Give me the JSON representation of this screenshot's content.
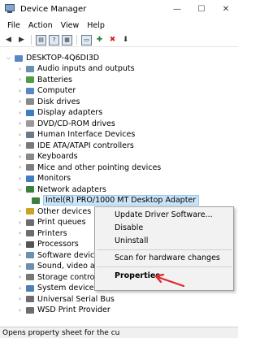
{
  "window": {
    "title": "Device Manager",
    "minimize": "—",
    "maximize": "☐",
    "close": "✕"
  },
  "menu": [
    "File",
    "Action",
    "View",
    "Help"
  ],
  "toolbar": {
    "icons": [
      "back-icon",
      "forward-icon",
      "properties-icon",
      "help-icon",
      "driver-icon",
      "monitor-icon",
      "add-device-icon",
      "uninstall-icon",
      "update-driver-icon"
    ]
  },
  "tree": {
    "root": "DESKTOP-4Q6DI3D",
    "items": [
      {
        "label": "Audio inputs and outputs",
        "icon": "speaker-icon",
        "color": "#6b8fb3"
      },
      {
        "label": "Batteries",
        "icon": "battery-icon",
        "color": "#4f9b4a"
      },
      {
        "label": "Computer",
        "icon": "computer-icon",
        "color": "#5a87c5"
      },
      {
        "label": "Disk drives",
        "icon": "disk-drive-icon",
        "color": "#8a8a8a"
      },
      {
        "label": "Display adapters",
        "icon": "display-adapter-icon",
        "color": "#3f7fc0"
      },
      {
        "label": "DVD/CD-ROM drives",
        "icon": "dvd-drive-icon",
        "color": "#9a9a9a"
      },
      {
        "label": "Human Interface Devices",
        "icon": "hid-icon",
        "color": "#6c7a8c"
      },
      {
        "label": "IDE ATA/ATAPI controllers",
        "icon": "ide-controller-icon",
        "color": "#7a7a7a"
      },
      {
        "label": "Keyboards",
        "icon": "keyboard-icon",
        "color": "#8a8a8a"
      },
      {
        "label": "Mice and other pointing devices",
        "icon": "mouse-icon",
        "color": "#7d7d7d"
      },
      {
        "label": "Monitors",
        "icon": "monitor-icon",
        "color": "#3f7fc0"
      },
      {
        "label": "Network adapters",
        "icon": "network-adapter-icon",
        "color": "#3d7f3d",
        "expanded": true
      },
      {
        "label": "Intel(R) PRO/1000 MT Desktop Adapter",
        "icon": "network-card-icon",
        "color": "#3d7f3d",
        "child": true,
        "selected": true
      },
      {
        "label": "Other devices",
        "icon": "other-devices-icon",
        "color": "#c9a227"
      },
      {
        "label": "Print queues",
        "icon": "printer-icon",
        "color": "#6d6d6d"
      },
      {
        "label": "Printers",
        "icon": "printer-icon",
        "color": "#6d6d6d"
      },
      {
        "label": "Processors",
        "icon": "processor-icon",
        "color": "#555555"
      },
      {
        "label": "Software devices",
        "icon": "software-device-icon",
        "color": "#6f8fb0"
      },
      {
        "label": "Sound, video and",
        "icon": "sound-icon",
        "color": "#6b8fb3"
      },
      {
        "label": "Storage controllers",
        "icon": "storage-controller-icon",
        "color": "#777777"
      },
      {
        "label": "System devices",
        "icon": "system-device-icon",
        "color": "#4f7fb5"
      },
      {
        "label": "Universal Serial Bus",
        "icon": "usb-icon",
        "color": "#6d6d6d"
      },
      {
        "label": "WSD Print Provider",
        "icon": "printer-icon",
        "color": "#6d6d6d"
      }
    ]
  },
  "context_menu": {
    "items": [
      "Update Driver Software...",
      "Disable",
      "Uninstall",
      "Scan for hardware changes",
      "Properties"
    ]
  },
  "status": {
    "text": "Opens property sheet for the cu"
  },
  "colors": {
    "selection": "#cce4f7",
    "arrow": "#e0262a"
  }
}
